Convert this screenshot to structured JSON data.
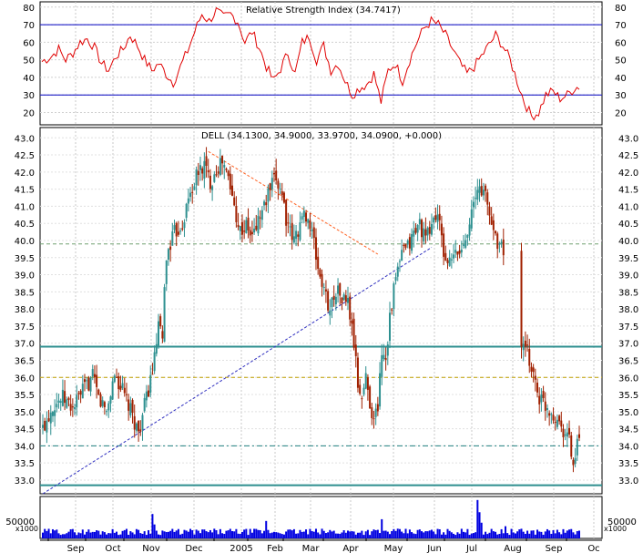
{
  "chart_data": [
    {
      "type": "line",
      "panel": "rsi",
      "title": "Relative Strength Index (34.7417)",
      "ylim": [
        13,
        83
      ],
      "yticks": [
        20,
        30,
        40,
        50,
        60,
        70,
        80
      ],
      "reference_lines": [
        30,
        70
      ],
      "line_color": "#e00000",
      "ref_color": "#0000c0",
      "keypoints": [
        [
          0,
          49
        ],
        [
          4,
          52
        ],
        [
          7,
          56
        ],
        [
          10,
          50
        ],
        [
          13,
          54
        ],
        [
          16,
          60
        ],
        [
          19,
          62
        ],
        [
          22,
          57
        ],
        [
          25,
          48
        ],
        [
          28,
          44
        ],
        [
          31,
          52
        ],
        [
          34,
          56
        ],
        [
          37,
          64
        ],
        [
          40,
          58
        ],
        [
          43,
          50
        ],
        [
          46,
          44
        ],
        [
          49,
          48
        ],
        [
          52,
          42
        ],
        [
          55,
          37
        ],
        [
          58,
          46
        ],
        [
          61,
          55
        ],
        [
          64,
          66
        ],
        [
          67,
          76
        ],
        [
          70,
          72
        ],
        [
          73,
          78
        ],
        [
          76,
          74
        ],
        [
          79,
          76
        ],
        [
          82,
          72
        ],
        [
          85,
          60
        ],
        [
          88,
          66
        ],
        [
          91,
          57
        ],
        [
          94,
          46
        ],
        [
          97,
          38
        ],
        [
          100,
          45
        ],
        [
          103,
          54
        ],
        [
          106,
          42
        ],
        [
          109,
          60
        ],
        [
          112,
          63
        ],
        [
          115,
          50
        ],
        [
          118,
          58
        ],
        [
          121,
          44
        ],
        [
          124,
          48
        ],
        [
          127,
          38
        ],
        [
          130,
          30
        ],
        [
          133,
          34
        ],
        [
          136,
          36
        ],
        [
          139,
          42
        ],
        [
          142,
          26
        ],
        [
          145,
          44
        ],
        [
          148,
          48
        ],
        [
          151,
          38
        ],
        [
          154,
          50
        ],
        [
          157,
          60
        ],
        [
          160,
          68
        ],
        [
          163,
          72
        ],
        [
          166,
          70
        ],
        [
          169,
          64
        ],
        [
          172,
          56
        ],
        [
          175,
          48
        ],
        [
          178,
          42
        ],
        [
          181,
          46
        ],
        [
          184,
          52
        ],
        [
          187,
          58
        ],
        [
          190,
          64
        ],
        [
          193,
          58
        ],
        [
          196,
          50
        ],
        [
          199,
          38
        ],
        [
          202,
          26
        ],
        [
          205,
          18
        ],
        [
          208,
          20
        ],
        [
          211,
          30
        ],
        [
          214,
          32
        ],
        [
          217,
          28
        ],
        [
          220,
          30
        ],
        [
          223,
          34
        ],
        [
          226,
          35
        ]
      ],
      "n_points": 226
    },
    {
      "type": "candlestick",
      "panel": "price",
      "title": "DELL (34.1300, 34.9000, 33.9700, 34.0900, +0.000)",
      "ylim": [
        32.6,
        43.3
      ],
      "yticks": [
        33.0,
        33.5,
        34.0,
        34.5,
        35.0,
        35.5,
        36.0,
        36.5,
        37.0,
        37.5,
        38.0,
        38.5,
        39.0,
        39.5,
        40.0,
        40.5,
        41.0,
        41.5,
        42.0,
        42.5,
        43.0
      ],
      "up_color": "#2e9090",
      "down_color": "#a02000",
      "close_keypoints": [
        [
          0,
          34.5
        ],
        [
          5,
          35.2
        ],
        [
          10,
          35.4
        ],
        [
          15,
          35.1
        ],
        [
          20,
          35.6
        ],
        [
          25,
          36.0
        ],
        [
          28,
          35.4
        ],
        [
          32,
          35.0
        ],
        [
          36,
          36.1
        ],
        [
          40,
          35.6
        ],
        [
          44,
          35.0
        ],
        [
          48,
          34.4
        ],
        [
          52,
          35.4
        ],
        [
          56,
          36.5
        ],
        [
          58,
          37.5
        ],
        [
          60,
          37.0
        ],
        [
          61,
          38.8
        ],
        [
          63,
          39.8
        ],
        [
          66,
          40.2
        ],
        [
          70,
          40.5
        ],
        [
          74,
          41.4
        ],
        [
          78,
          42.0
        ],
        [
          81,
          42.2
        ],
        [
          84,
          41.7
        ],
        [
          87,
          42.1
        ],
        [
          90,
          42.3
        ],
        [
          93,
          41.8
        ],
        [
          96,
          41.0
        ],
        [
          99,
          40.3
        ],
        [
          102,
          40.4
        ],
        [
          105,
          40.1
        ],
        [
          108,
          40.6
        ],
        [
          111,
          41.0
        ],
        [
          114,
          41.5
        ],
        [
          117,
          41.8
        ],
        [
          120,
          41.4
        ],
        [
          123,
          40.3
        ],
        [
          126,
          40.0
        ],
        [
          129,
          40.5
        ],
        [
          132,
          40.8
        ],
        [
          135,
          40.2
        ],
        [
          138,
          39.2
        ],
        [
          141,
          38.5
        ],
        [
          144,
          38.0
        ],
        [
          147,
          38.6
        ],
        [
          150,
          38.3
        ],
        [
          153,
          38.2
        ],
        [
          156,
          37.0
        ],
        [
          158,
          35.8
        ],
        [
          160,
          35.4
        ],
        [
          162,
          36.0
        ],
        [
          164,
          35.3
        ],
        [
          166,
          34.7
        ],
        [
          168,
          35.2
        ],
        [
          170,
          36.8
        ],
        [
          172,
          36.6
        ],
        [
          174,
          37.8
        ],
        [
          177,
          38.9
        ],
        [
          180,
          39.6
        ],
        [
          183,
          39.8
        ],
        [
          186,
          40.2
        ],
        [
          189,
          40.5
        ],
        [
          192,
          40.0
        ],
        [
          195,
          40.5
        ],
        [
          198,
          40.8
        ],
        [
          201,
          39.6
        ],
        [
          204,
          39.3
        ],
        [
          207,
          39.6
        ],
        [
          210,
          39.7
        ],
        [
          213,
          40.4
        ],
        [
          216,
          41.0
        ],
        [
          219,
          41.6
        ],
        [
          222,
          41.3
        ],
        [
          225,
          40.5
        ],
        [
          228,
          40.0
        ],
        [
          231,
          39.7
        ]
      ],
      "gap": [
        232,
        240
      ],
      "close_keypoints_b": [
        [
          240,
          36.9
        ],
        [
          243,
          36.7
        ],
        [
          246,
          36.1
        ],
        [
          249,
          35.4
        ],
        [
          252,
          35.2
        ],
        [
          255,
          35.0
        ],
        [
          258,
          34.8
        ],
        [
          261,
          34.5
        ],
        [
          264,
          34.2
        ],
        [
          266,
          33.4
        ],
        [
          268,
          34.0
        ],
        [
          269,
          34.1
        ]
      ],
      "n_points": 270,
      "horizontal_lines": [
        {
          "value": 36.9,
          "style": "solid",
          "color": "#2e8f8f"
        },
        {
          "value": 32.85,
          "style": "solid",
          "color": "#2e8f8f"
        },
        {
          "value": 39.9,
          "style": "dashed",
          "color": "#70a070"
        },
        {
          "value": 36.0,
          "style": "dashed",
          "color": "#c0a000"
        },
        {
          "value": 34.0,
          "style": "dashdot",
          "color": "#208080"
        }
      ],
      "trendlines": [
        {
          "from": [
            0,
            32.6
          ],
          "to": [
            195,
            39.8
          ],
          "color": "#3030c0",
          "style": "dashed"
        },
        {
          "from": [
            83,
            42.6
          ],
          "to": [
            168,
            39.6
          ],
          "color": "#ff6020",
          "style": "dashed"
        }
      ]
    },
    {
      "type": "bar",
      "panel": "volume",
      "units_label": "x1000",
      "yticks": [
        50000
      ],
      "ylim": [
        0,
        120000
      ],
      "color": "#0000e0",
      "base_value": 20000,
      "spikes": [
        [
          55,
          70000
        ],
        [
          56,
          40000
        ],
        [
          112,
          50000
        ],
        [
          170,
          55000
        ],
        [
          218,
          110000
        ],
        [
          219,
          75000
        ],
        [
          220,
          45000
        ],
        [
          232,
          35000
        ]
      ]
    }
  ],
  "x_axis": {
    "month_labels": [
      "Sep",
      "Oct",
      "Nov",
      "Dec",
      "2005",
      "Feb",
      "Mar",
      "Apr",
      "May",
      "Jun",
      "Jul",
      "Aug",
      "Sep",
      "Oc"
    ]
  }
}
